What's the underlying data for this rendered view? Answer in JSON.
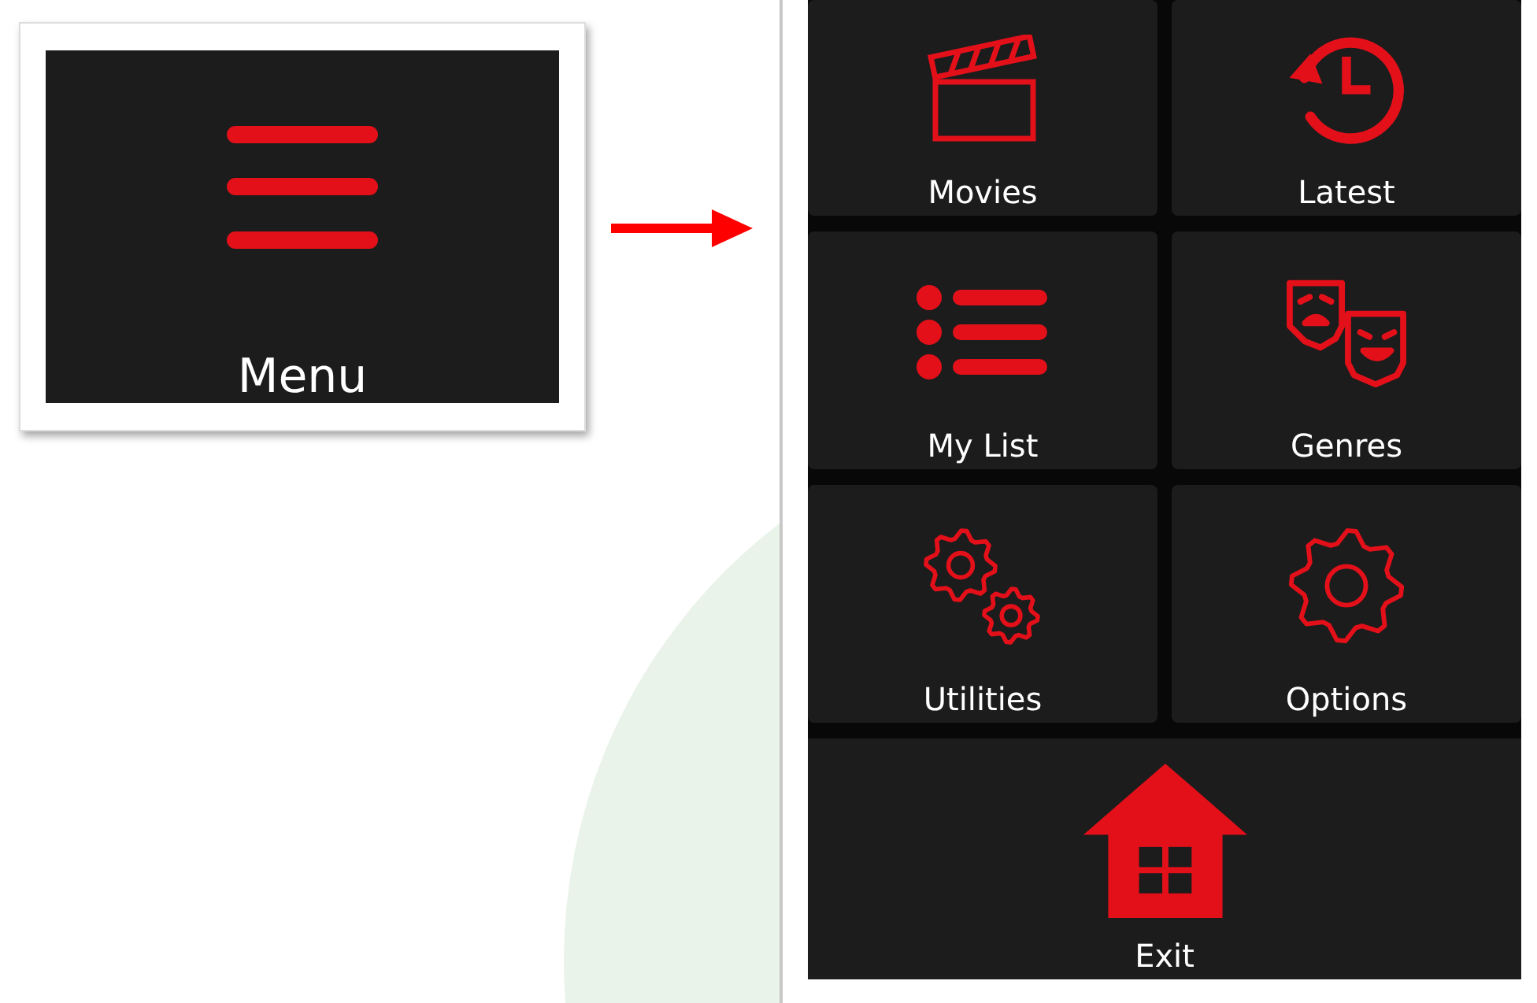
{
  "menu_button": {
    "label": "Menu"
  },
  "menu_tiles": [
    {
      "label": "Movies",
      "kind": "tile"
    },
    {
      "label": "Latest",
      "kind": "tile"
    },
    {
      "label": "My List",
      "kind": "tile"
    },
    {
      "label": "Genres",
      "kind": "tile"
    },
    {
      "label": "Utilities",
      "kind": "tile"
    },
    {
      "label": "Options",
      "kind": "tile"
    },
    {
      "label": "Exit",
      "kind": "wide"
    }
  ]
}
